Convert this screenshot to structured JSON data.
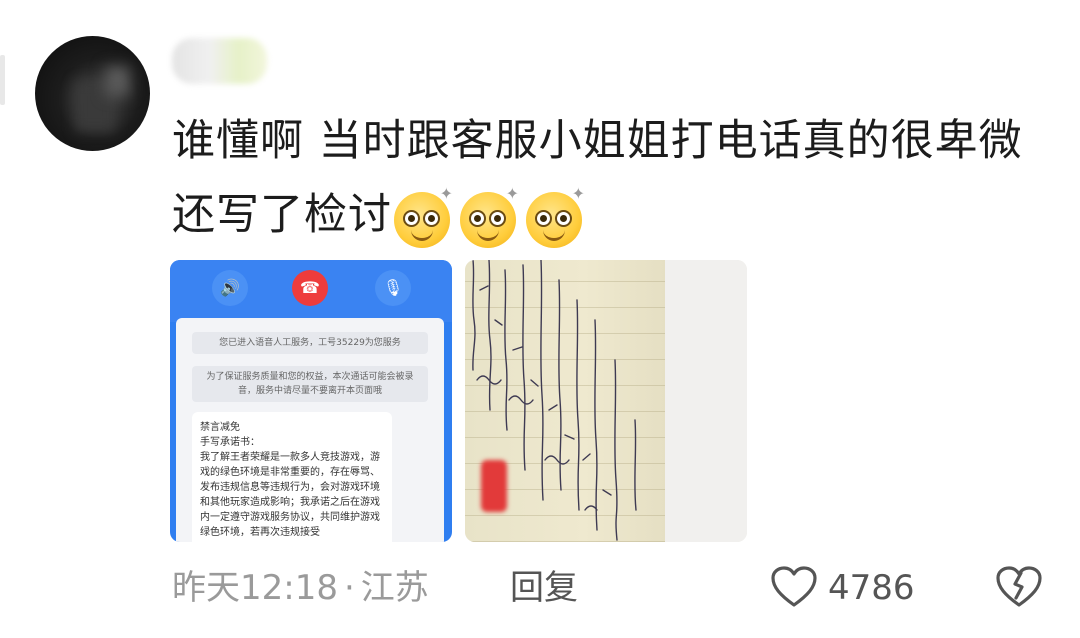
{
  "comment": {
    "text": "谁懂啊 当时跟客服小姐姐打电话真的很卑微 还写了检讨",
    "emoji_count": 3,
    "emoji_icon": "dizzy-smile-emoji"
  },
  "attachments": {
    "call_screenshot": {
      "system_message_1": "您已进入语音人工服务，工号35229为您服务",
      "system_message_2": "为了保证服务质量和您的权益，本次通话可能会被录音，服务中请尽量不要离开本页面哦",
      "bubble_title": "禁言减免",
      "bubble_subtitle": "手写承诺书：",
      "bubble_body": "我了解王者荣耀是一款多人竞技游戏，游戏的绿色环境是非常重要的，存在辱骂、发布违规信息等违规行为，会对游戏环境和其他玩家造成影响；我承诺之后在游戏内一定遵守游戏服务协议，共同维护游戏绿色环境，若再次违规接受"
    }
  },
  "meta": {
    "time": "昨天12:18",
    "separator": "·",
    "location": "江苏",
    "reply_label": "回复",
    "like_count": "4786"
  },
  "colors": {
    "call_bar": "#3a83f2",
    "hangup": "#ee3c3c",
    "meta_text": "#9a9a9a"
  }
}
